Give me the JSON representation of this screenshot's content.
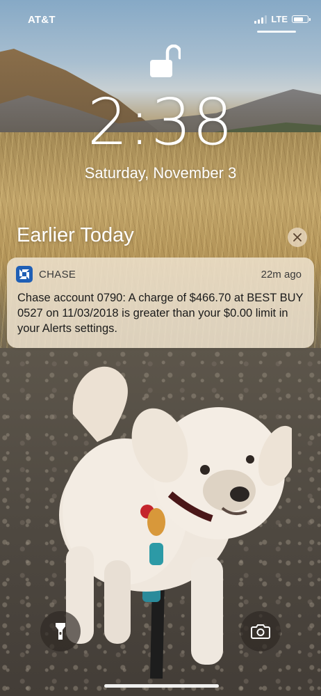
{
  "status_bar": {
    "carrier": "AT&T",
    "network": "LTE",
    "signal_bars": 3,
    "battery_level": 0.7
  },
  "lock_screen": {
    "lock_state_icon": "unlock-icon",
    "time": "2:38",
    "date": "Saturday, November 3"
  },
  "notifications": {
    "section_title": "Earlier Today",
    "clear_icon": "close-icon",
    "items": [
      {
        "app_name": "CHASE",
        "time_ago": "22m ago",
        "body": "Chase account 0790: A charge of $466.70 at BEST BUY 0527 on 11/03/2018 is greater than your $0.00 limit in your Alerts settings.",
        "app_icon": "chase-logo-icon",
        "brand_color": "#1f5fb5"
      }
    ]
  },
  "controls": {
    "left_icon": "flashlight-icon",
    "right_icon": "camera-icon"
  }
}
